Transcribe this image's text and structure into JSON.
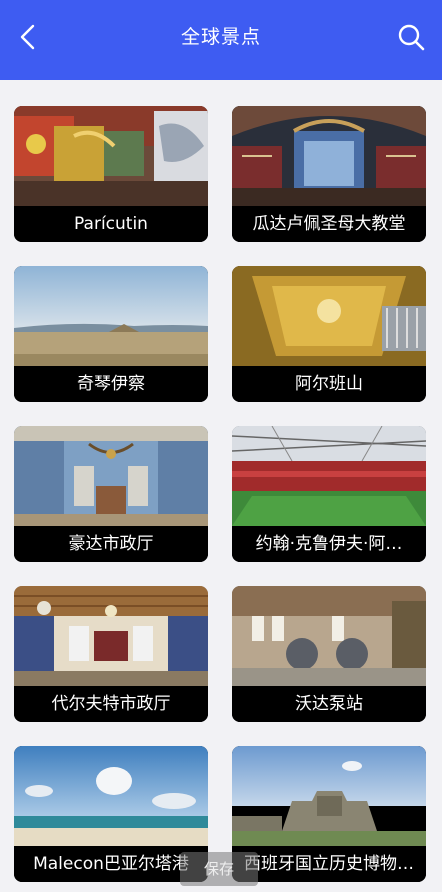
{
  "header": {
    "title": "全球景点",
    "back_icon": "chevron-left-icon",
    "search_icon": "search-icon",
    "background": "#3e5cf2"
  },
  "places": [
    {
      "label": "Parícutin"
    },
    {
      "label": "瓜达卢佩圣母大教堂"
    },
    {
      "label": "奇琴伊察"
    },
    {
      "label": "阿尔班山"
    },
    {
      "label": "豪达市政厅"
    },
    {
      "label": "约翰·克鲁伊夫·阿…"
    },
    {
      "label": "代尔夫特市政厅"
    },
    {
      "label": "沃达泵站"
    },
    {
      "label": "Malecon巴亚尔塔港"
    },
    {
      "label": "西班牙国立历史博物…"
    }
  ],
  "toast": {
    "text": "保存"
  }
}
